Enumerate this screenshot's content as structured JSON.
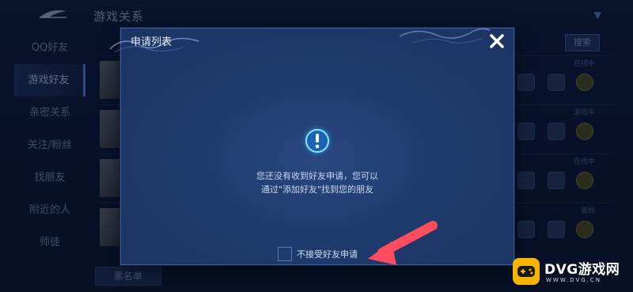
{
  "background": {
    "title": "游戏关系",
    "sidebar": [
      {
        "label": "QQ好友",
        "active": false
      },
      {
        "label": "游戏好友",
        "active": true
      },
      {
        "label": "亲密关系",
        "active": false
      },
      {
        "label": "关注/粉丝",
        "active": false
      },
      {
        "label": "找朋友",
        "active": false
      },
      {
        "label": "附近的人",
        "active": false
      },
      {
        "label": "师徒",
        "active": false
      }
    ],
    "search_label": "搜索",
    "blacklist_label": "黑名单",
    "rows": [
      {
        "status": "在线中"
      },
      {
        "status": "游戏中"
      },
      {
        "status": "在线中"
      },
      {
        "status": "离线"
      }
    ]
  },
  "modal": {
    "title": "申请列表",
    "close_icon": "close-icon",
    "empty_message_line1": "您还没有收到好友申请，您可以",
    "empty_message_line2": "通过\"添加好友\"找到您的朋友",
    "reject_label": "不接受好友申请",
    "reject_checked": false
  },
  "watermark": {
    "brand": "DVG游戏网",
    "url": "WWW.DVG.CN"
  },
  "colors": {
    "accent": "#4d7fd0",
    "annotation_arrow": "#ff4d5e",
    "watermark_badge": "#f4b400"
  }
}
